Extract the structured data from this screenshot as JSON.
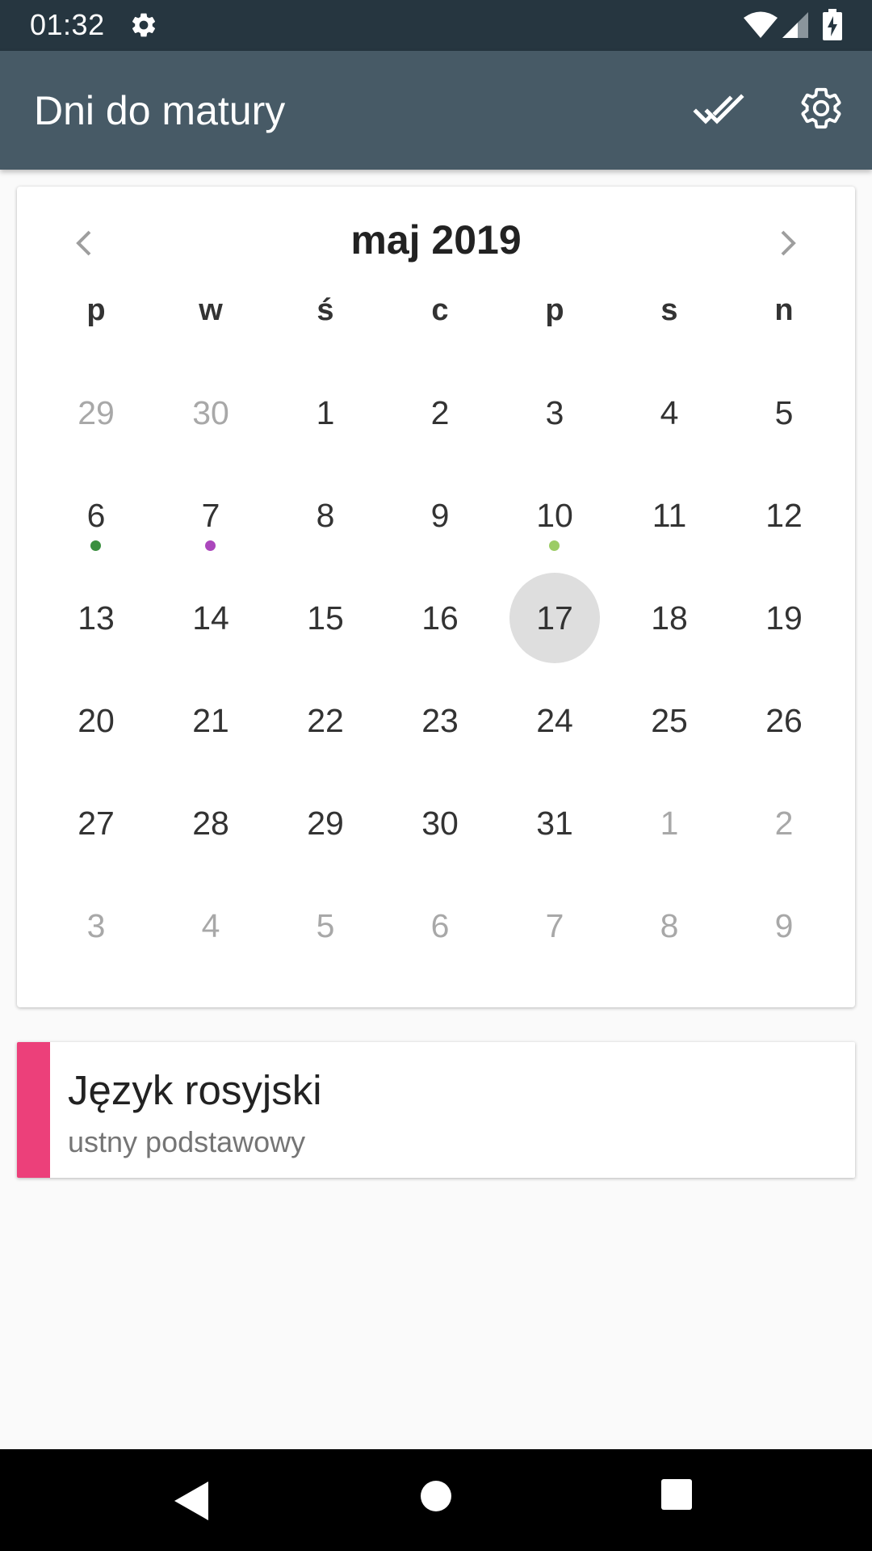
{
  "status_bar": {
    "time": "01:32",
    "icons": [
      "settings-icon",
      "wifi-icon",
      "signal-icon",
      "battery-charging-icon"
    ]
  },
  "app_bar": {
    "title": "Dni do matury",
    "actions": [
      "done-all-icon",
      "settings-icon"
    ]
  },
  "calendar": {
    "month_label": "maj 2019",
    "weekdays": [
      "p",
      "w",
      "ś",
      "c",
      "p",
      "s",
      "n"
    ],
    "weeks": [
      [
        {
          "d": "29",
          "other": true
        },
        {
          "d": "30",
          "other": true
        },
        {
          "d": "1"
        },
        {
          "d": "2"
        },
        {
          "d": "3"
        },
        {
          "d": "4"
        },
        {
          "d": "5"
        }
      ],
      [
        {
          "d": "6",
          "dot": "#3a8f3f"
        },
        {
          "d": "7",
          "dot": "#ab47bc"
        },
        {
          "d": "8"
        },
        {
          "d": "9"
        },
        {
          "d": "10",
          "dot": "#9ccc65"
        },
        {
          "d": "11"
        },
        {
          "d": "12"
        }
      ],
      [
        {
          "d": "13"
        },
        {
          "d": "14"
        },
        {
          "d": "15"
        },
        {
          "d": "16"
        },
        {
          "d": "17",
          "selected": true
        },
        {
          "d": "18"
        },
        {
          "d": "19"
        }
      ],
      [
        {
          "d": "20"
        },
        {
          "d": "21"
        },
        {
          "d": "22"
        },
        {
          "d": "23"
        },
        {
          "d": "24"
        },
        {
          "d": "25"
        },
        {
          "d": "26"
        }
      ],
      [
        {
          "d": "27"
        },
        {
          "d": "28"
        },
        {
          "d": "29"
        },
        {
          "d": "30"
        },
        {
          "d": "31"
        },
        {
          "d": "1",
          "other": true
        },
        {
          "d": "2",
          "other": true
        }
      ],
      [
        {
          "d": "3",
          "other": true
        },
        {
          "d": "4",
          "other": true
        },
        {
          "d": "5",
          "other": true
        },
        {
          "d": "6",
          "other": true
        },
        {
          "d": "7",
          "other": true
        },
        {
          "d": "8",
          "other": true
        },
        {
          "d": "9",
          "other": true
        }
      ]
    ]
  },
  "event": {
    "title": "Język rosyjski",
    "subtitle": "ustny podstawowy",
    "color": "#ec407a"
  },
  "nav_bar": {
    "buttons": [
      "back-icon",
      "home-icon",
      "recents-icon"
    ]
  },
  "colors": {
    "status_bar": "#263640",
    "app_bar": "#475a66",
    "selected_day": "#dedede"
  }
}
